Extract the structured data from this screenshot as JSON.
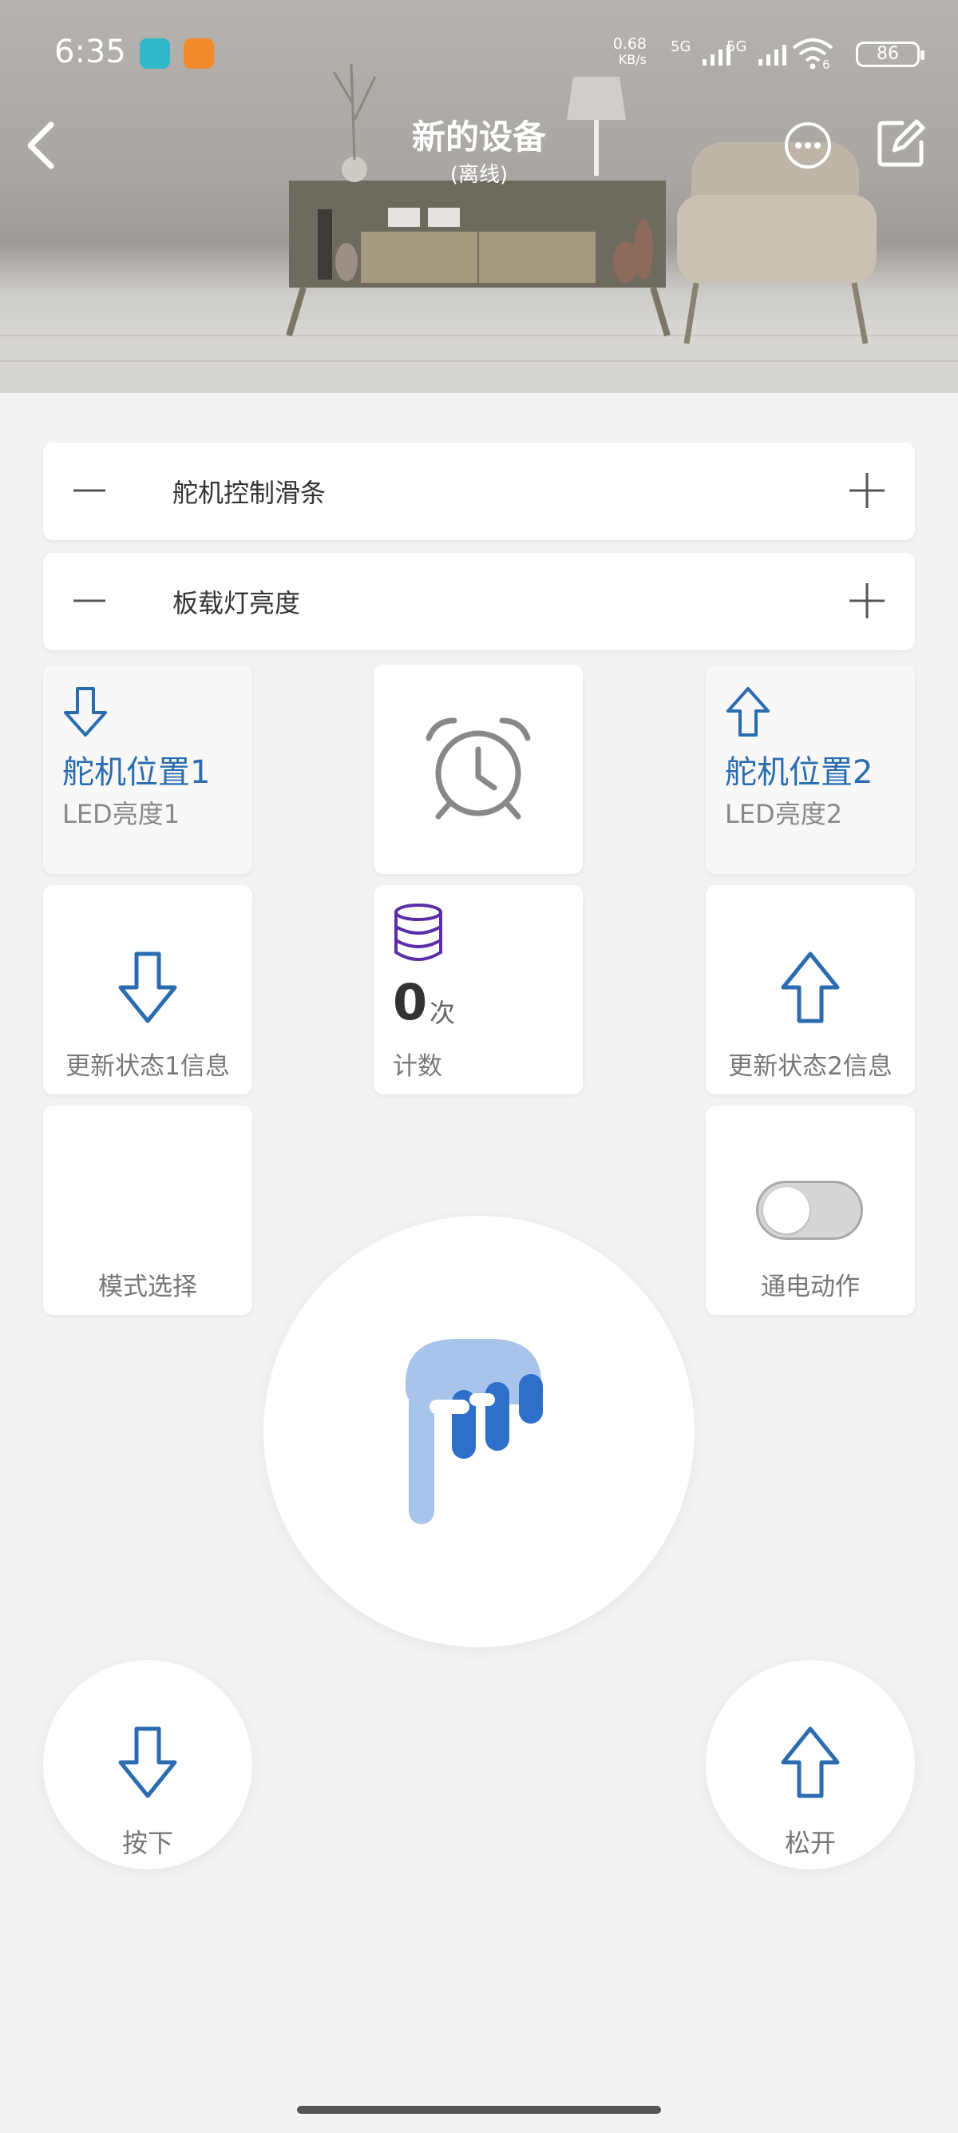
{
  "status_bar": {
    "time": "6:35",
    "net_speed_value": "0.68",
    "net_speed_unit": "KB/s",
    "signal1": "5G",
    "signal2": "5G",
    "wifi_sub": "6",
    "battery": "86"
  },
  "header": {
    "title": "新的设备",
    "subtitle": "(离线)"
  },
  "sliders": [
    {
      "label": "舵机控制滑条"
    },
    {
      "label": "板载灯亮度"
    }
  ],
  "tiles": {
    "position1": {
      "title": "舵机位置1",
      "subtitle": "LED亮度1"
    },
    "timer": {
      "icon": "alarm-clock-icon"
    },
    "position2": {
      "title": "舵机位置2",
      "subtitle": "LED亮度2"
    },
    "update1": {
      "label": "更新状态1信息"
    },
    "counter": {
      "value": "0",
      "unit": "次",
      "label": "计数"
    },
    "update2": {
      "label": "更新状态2信息"
    },
    "mode": {
      "label": "模式选择"
    },
    "power": {
      "label": "通电动作",
      "on": false
    }
  },
  "main_button": {
    "icon": "paint-drip-icon"
  },
  "bottom_buttons": {
    "press": {
      "label": "按下"
    },
    "release": {
      "label": "松开"
    }
  },
  "colors": {
    "accent_blue": "#2b6cb0",
    "icon_purple": "#5a2ea6",
    "logo_light": "#a9c4ea",
    "logo_dark": "#2e6fcb"
  }
}
